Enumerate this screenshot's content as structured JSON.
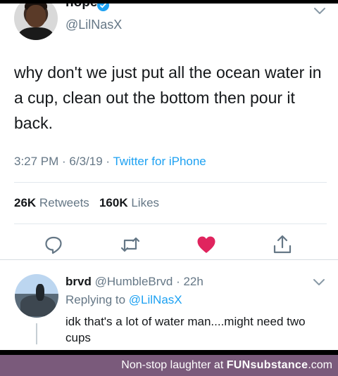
{
  "tweet": {
    "name": "nope",
    "handle": "@LilNasX",
    "text": "why don't we just put all the ocean water in a cup, clean out the bottom then pour it back.",
    "time": "3:27 PM · 6/3/19 · ",
    "source": "Twitter for iPhone",
    "retweets_count": "26K",
    "retweets_label": "Retweets",
    "likes_count": "160K",
    "likes_label": "Likes"
  },
  "reply": {
    "name": "brvd",
    "handle_time": "@HumbleBrvd · 22h",
    "replying_label": "Replying to ",
    "replying_to": "@LilNasX",
    "text": "idk that's a lot of water man....might need two cups"
  },
  "footer": {
    "prefix": "Non-stop laughter at ",
    "brand": "FUNsubstance",
    "suffix": ".com"
  },
  "colors": {
    "twitter_blue": "#1da1f2",
    "like_red": "#e0245e",
    "footer_bg": "#7a5a7b"
  },
  "icons": [
    "verified-icon",
    "caret-down-icon",
    "reply-icon",
    "retweet-icon",
    "like-icon",
    "share-icon"
  ]
}
